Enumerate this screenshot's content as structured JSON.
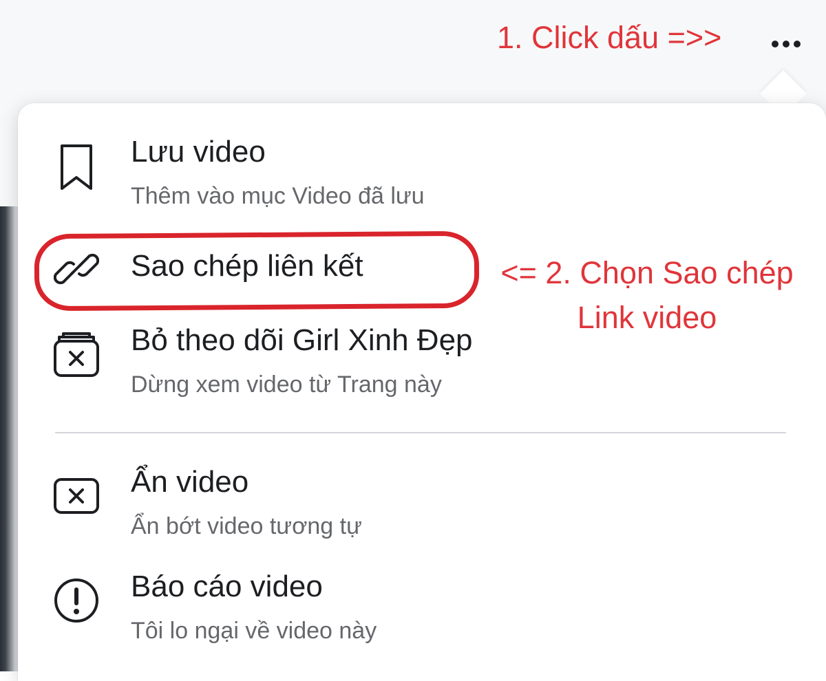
{
  "annotations": {
    "step1": "1. Click dấu  =>>",
    "step2_line1": "<= 2. Chọn Sao chép",
    "step2_line2": "Link video"
  },
  "menu": {
    "items": [
      {
        "title": "Lưu video",
        "subtitle": "Thêm vào mục Video đã lưu",
        "icon": "bookmark-icon"
      },
      {
        "title": "Sao chép liên kết",
        "subtitle": "",
        "icon": "link-icon"
      },
      {
        "title": "Bỏ theo dõi Girl Xinh Đẹp",
        "subtitle": "Dừng xem video từ Trang này",
        "icon": "unfollow-icon"
      },
      {
        "title": "Ẩn video",
        "subtitle": "Ẩn bớt video tương tự",
        "icon": "hide-icon"
      },
      {
        "title": "Báo cáo video",
        "subtitle": "Tôi lo ngại về video này",
        "icon": "report-icon"
      }
    ]
  },
  "colors": {
    "annotation": "#e0353a",
    "highlight": "#d9242c",
    "text_primary": "#1c1e21",
    "text_secondary": "#65676b"
  }
}
